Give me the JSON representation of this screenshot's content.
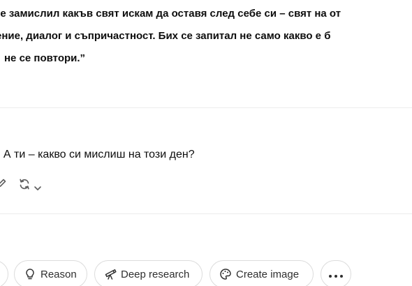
{
  "quote": {
    "line1": "се замислил какъв свят искам да оставя след себе си – свят на от",
    "line2": "ение, диалог и съпричастност. Бих се запитал не само какво е б",
    "line3": " не се повтори.”"
  },
  "answer": {
    "text": ". А ти – какво си мислиш на този ден?"
  },
  "message_actions": {
    "edit_icon": "pencil-icon",
    "regenerate_icon": "regenerate-icon",
    "dropdown_icon": "chevron-down-icon"
  },
  "toolbar": {
    "reason_label": "Reason",
    "deep_research_label": "Deep research",
    "create_image_label": "Create image",
    "reason_icon": "lightbulb-icon",
    "deep_research_icon": "telescope-icon",
    "create_image_icon": "palette-icon",
    "more_icon": "more-icon"
  }
}
